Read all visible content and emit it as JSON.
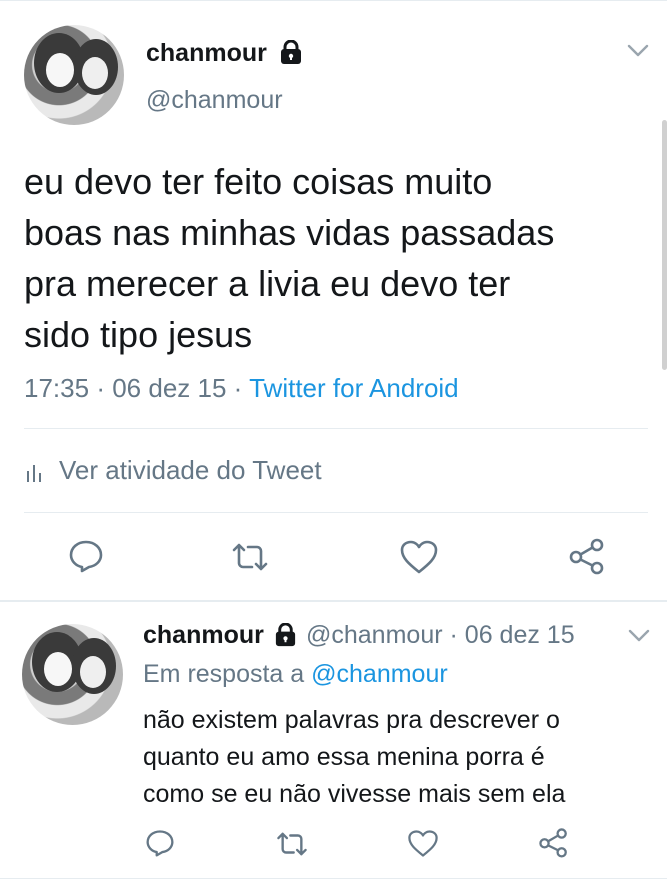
{
  "main_tweet": {
    "display_name": "chanmour",
    "handle": "@chanmour",
    "text": "eu devo ter feito coisas muito\nboas nas minhas vidas passadas\npra merecer a livia eu devo ter\nsido tipo jesus",
    "time": "17:35",
    "date": "06 dez 15",
    "source": "Twitter for Android",
    "separator": "·",
    "activity_label": "Ver atividade do Tweet",
    "icons": {
      "lock": "lock-icon",
      "menu": "chevron-down-icon",
      "activity": "bar-chart-icon",
      "reply": "reply-icon",
      "retweet": "retweet-icon",
      "like": "heart-icon",
      "share": "share-icon"
    }
  },
  "reply_tweet": {
    "display_name": "chanmour",
    "handle": "@chanmour",
    "separator": "·",
    "date": "06 dez 15",
    "in_reply_prefix": "Em resposta a",
    "in_reply_handle": "@chanmour",
    "text": "não existem palavras pra descrever o\nquanto eu amo essa menina porra é\ncomo se eu não vivesse mais sem ela"
  },
  "colors": {
    "text": "#14171a",
    "muted": "#657786",
    "link": "#1b95e0",
    "divider": "#e6ecf0",
    "icon": "#657786"
  }
}
